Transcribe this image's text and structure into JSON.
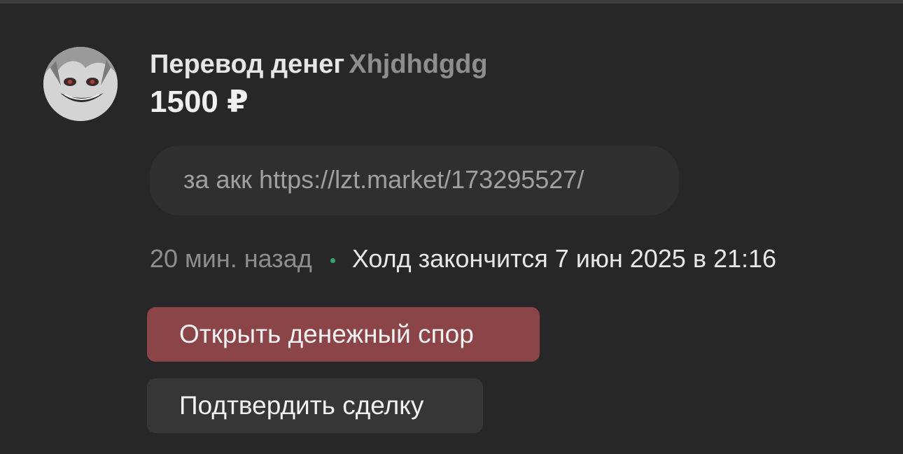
{
  "transfer": {
    "title": "Перевод денег",
    "username": "Xhjdhdgdg",
    "amount": "1500 ₽"
  },
  "message": {
    "text": "за акк https://lzt.market/173295527/"
  },
  "meta": {
    "time_ago": "20 мин. назад",
    "hold_text": "Холд закончится 7 июн 2025 в 21:16"
  },
  "actions": {
    "dispute_label": "Открыть денежный спор",
    "confirm_label": "Подтвердить сделку"
  },
  "colors": {
    "background": "#272727",
    "dispute_button": "#8b4448",
    "confirm_button": "#363636",
    "status_dot": "#2fa86a"
  },
  "icons": {
    "avatar": "user-avatar",
    "status": "online-dot-icon"
  }
}
